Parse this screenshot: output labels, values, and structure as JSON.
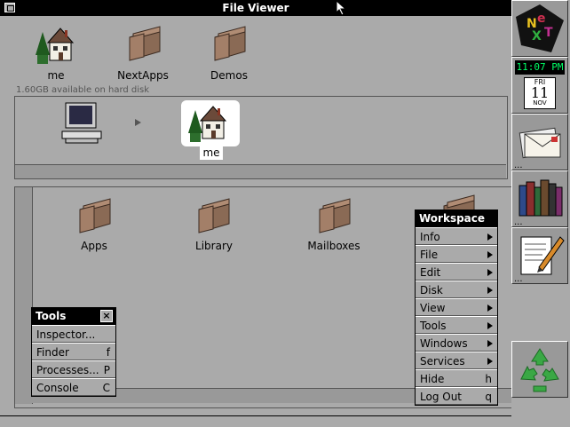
{
  "window": {
    "title": "File Viewer",
    "free_space": "1.60GB available on hard disk"
  },
  "shelf": [
    {
      "label": "me",
      "icon": "home-icon"
    },
    {
      "label": "NextApps",
      "icon": "folder-icon"
    },
    {
      "label": "Demos",
      "icon": "folder-icon"
    }
  ],
  "browser": {
    "path_icon": "computer-icon",
    "selected": {
      "label": "me",
      "icon": "home-icon"
    }
  },
  "contents": [
    {
      "label": "Apps",
      "icon": "folder-icon"
    },
    {
      "label": "Library",
      "icon": "folder-icon"
    },
    {
      "label": "Mailboxes",
      "icon": "folder-icon"
    }
  ],
  "tools_menu": {
    "title": "Tools",
    "items": [
      {
        "label": "Inspector...",
        "key": ""
      },
      {
        "label": "Finder",
        "key": "f"
      },
      {
        "label": "Processes...",
        "key": "P"
      },
      {
        "label": "Console",
        "key": "C"
      }
    ]
  },
  "workspace_menu": {
    "title": "Workspace",
    "items": [
      {
        "label": "Info",
        "key": "",
        "submenu": true
      },
      {
        "label": "File",
        "key": "",
        "submenu": true
      },
      {
        "label": "Edit",
        "key": "",
        "submenu": true
      },
      {
        "label": "Disk",
        "key": "",
        "submenu": true
      },
      {
        "label": "View",
        "key": "",
        "submenu": true
      },
      {
        "label": "Tools",
        "key": "",
        "submenu": true
      },
      {
        "label": "Windows",
        "key": "",
        "submenu": true
      },
      {
        "label": "Services",
        "key": "",
        "submenu": true
      },
      {
        "label": "Hide",
        "key": "h",
        "submenu": false
      },
      {
        "label": "Log Out",
        "key": "q",
        "submenu": false
      }
    ]
  },
  "dock": {
    "clock": {
      "time": "11:07 PM",
      "day": "FRI",
      "date": "11",
      "month": "NOV"
    },
    "icons": [
      "next-logo-icon",
      "clock-icon",
      "mail-icon",
      "books-icon",
      "edit-icon",
      "recycler-icon"
    ]
  },
  "colors": {
    "background": "#aaaaaa",
    "titlebar": "#000000",
    "clock_digits": "#00ff66"
  }
}
